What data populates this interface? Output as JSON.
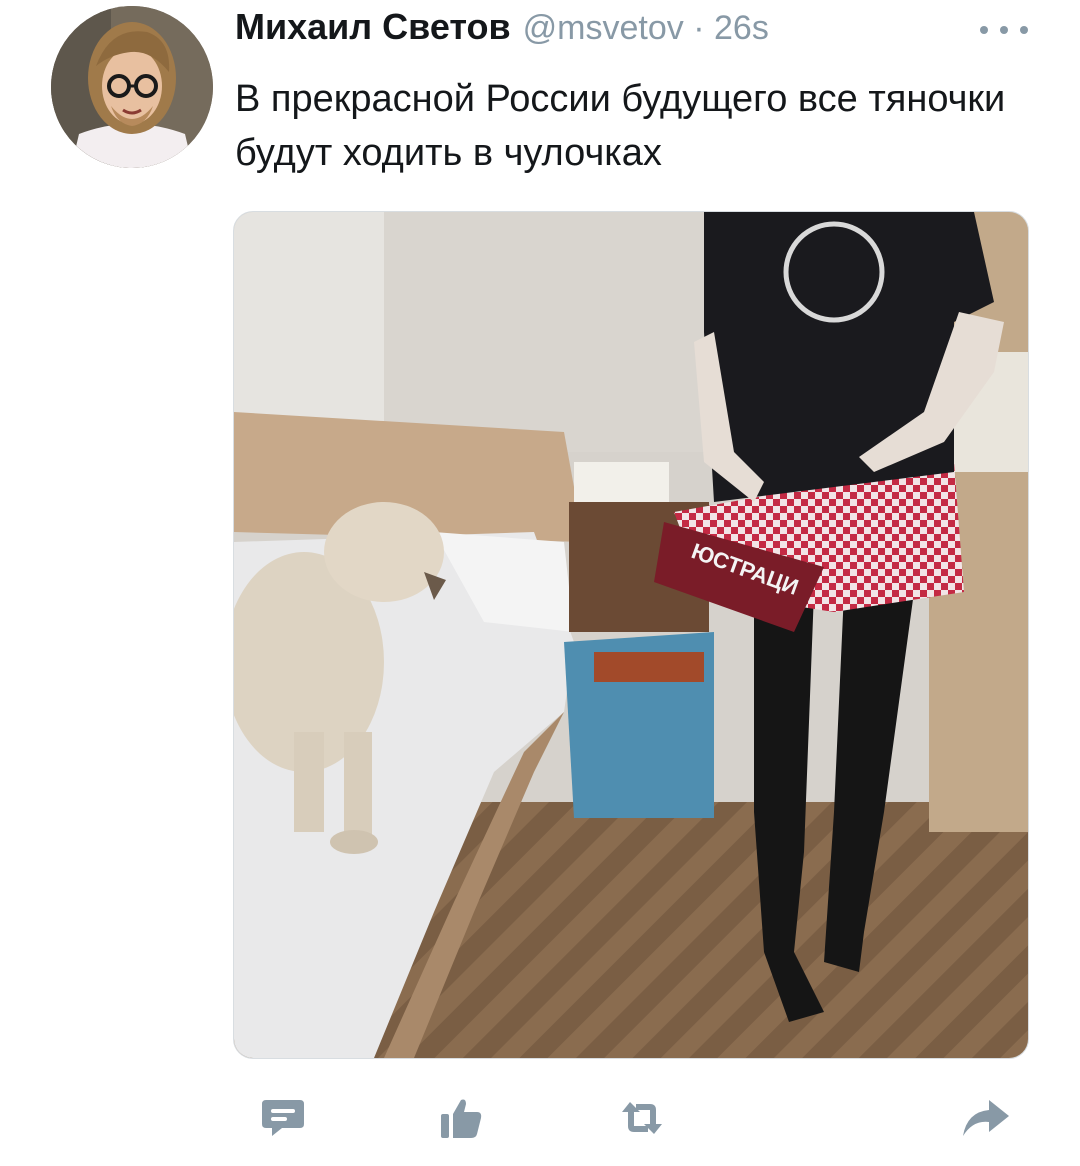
{
  "tweet": {
    "author": {
      "display_name": "Михаил Светов",
      "handle": "@msvetov",
      "separator": "·",
      "time": "26s"
    },
    "text": "В прекрасной России будущего все тяночки будут ходить в чулочках"
  },
  "media": {
    "description_icon": "photo-attachment",
    "print_text": "ЮСТРАЦИ"
  },
  "actions": {
    "items": [
      {
        "icon": "reply-icon"
      },
      {
        "icon": "like-icon"
      },
      {
        "icon": "retweet-icon"
      },
      {
        "icon": "share-icon"
      }
    ]
  },
  "colors": {
    "text_primary": "#14171a",
    "text_secondary": "#8899a6",
    "icon": "#8899a6"
  }
}
